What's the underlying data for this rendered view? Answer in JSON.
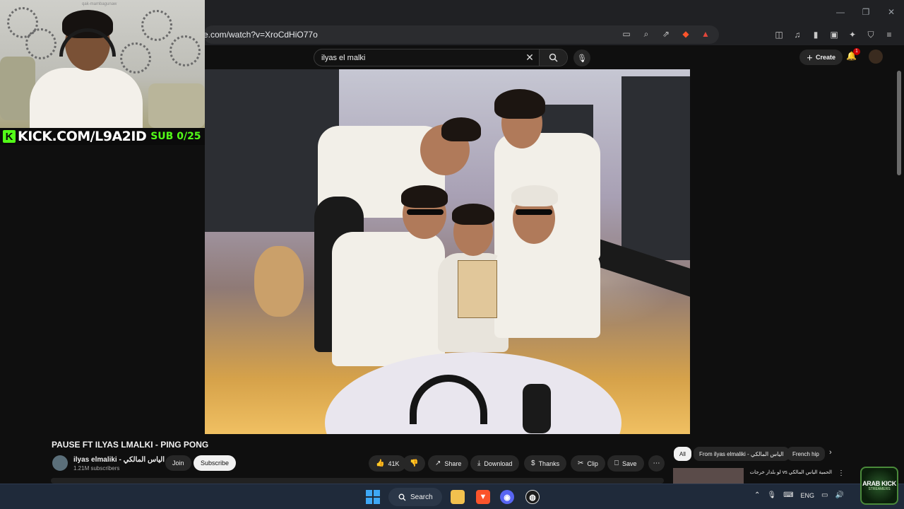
{
  "browser": {
    "url": "e.com/watch?v=XroCdHiO77o",
    "window_controls": [
      "—",
      "❐",
      "✕"
    ]
  },
  "youtube": {
    "search_value": "ilyas el malki",
    "create_label": "Create",
    "notification_count": "1"
  },
  "webcam": {
    "watermark": "qak-mambagunaw",
    "kick_label": "KICK.COM/L9A2ID",
    "sub_label": "SUB 0/25"
  },
  "video": {
    "title": "PAUSE FT ILYAS LMALKI - PING PONG",
    "channel_name": "ilyas elmaliki - الياس المالكي",
    "subscribers": "1.21M subscribers",
    "join_label": "Join",
    "subscribe_label": "Subscribe",
    "like_count": "41K",
    "share_label": "Share",
    "download_label": "Download",
    "thanks_label": "Thanks",
    "clip_label": "Clip",
    "save_label": "Save"
  },
  "chips": {
    "all": "All",
    "from_channel": "From ilyas elmaliki - الياس المالكي",
    "french_hip": "French hip"
  },
  "recommendation": {
    "title": "الحمية الياس المالكي vs لو بلدار خرجات"
  },
  "taskbar": {
    "search_label": "Search",
    "language": "ENG"
  },
  "watermark_logo": {
    "line1": "ARAB KICK",
    "line2": "STREAMERS"
  },
  "colors": {
    "kick_green": "#53fc18",
    "yt_bg": "#0f0f0f",
    "taskbar": "#1f2a3a"
  }
}
